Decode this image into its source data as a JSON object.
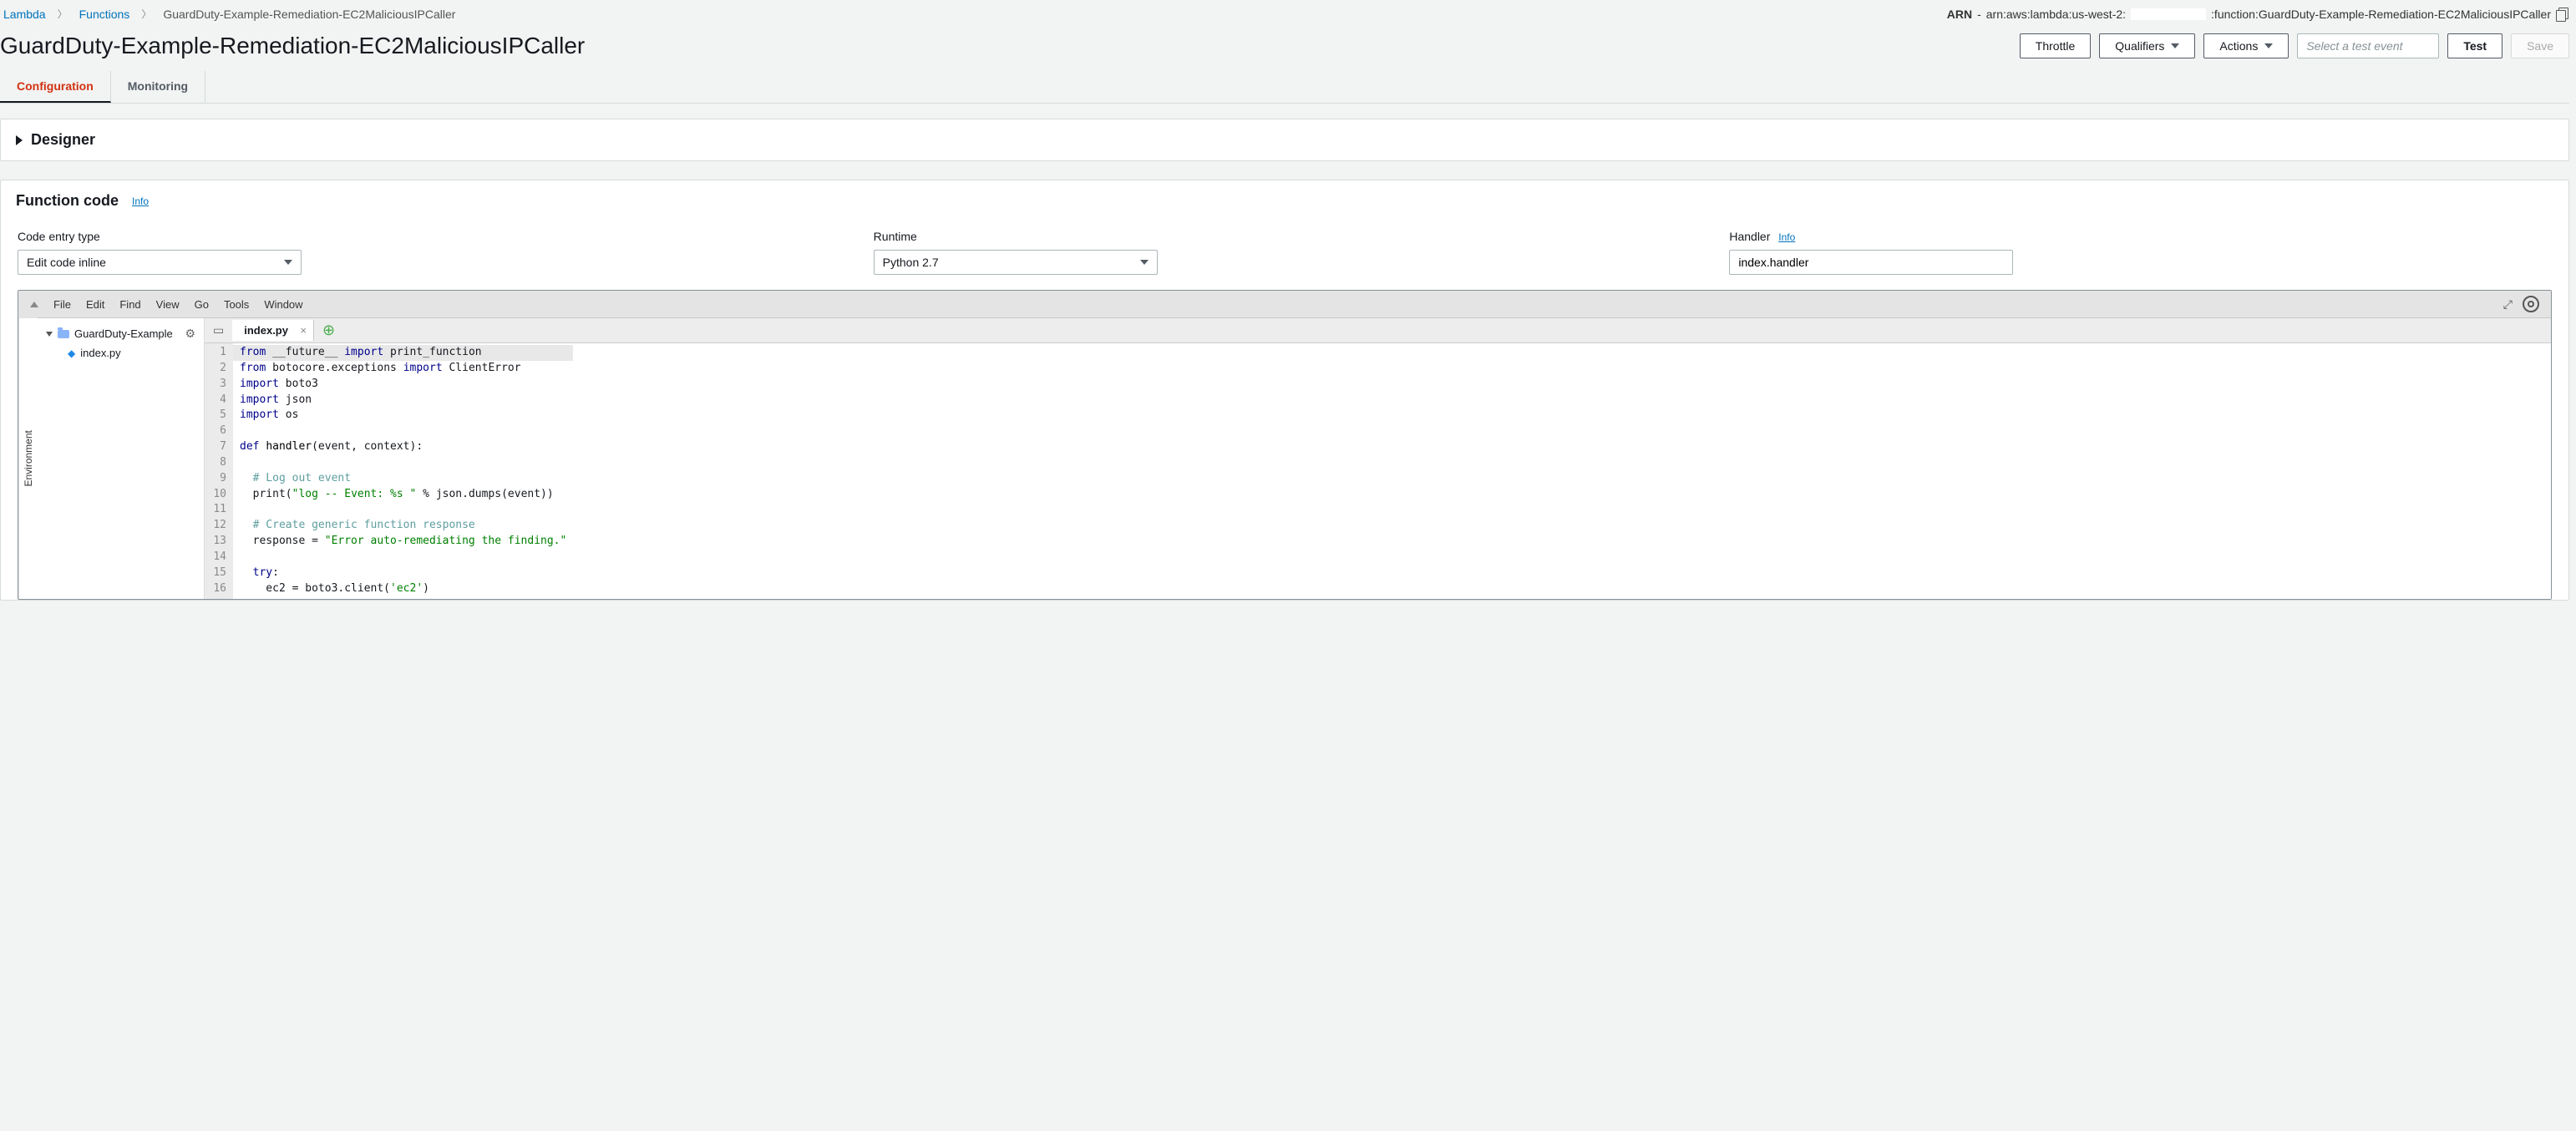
{
  "breadcrumbs": {
    "root": "Lambda",
    "mid": "Functions",
    "current": "GuardDuty-Example-Remediation-EC2MaliciousIPCaller"
  },
  "arn": {
    "label": "ARN",
    "prefix": "arn:aws:lambda:us-west-2:",
    "suffix": ":function:GuardDuty-Example-Remediation-EC2MaliciousIPCaller"
  },
  "title": "GuardDuty-Example-Remediation-EC2MaliciousIPCaller",
  "actions": {
    "throttle": "Throttle",
    "qualifiers": "Qualifiers",
    "actionsBtn": "Actions",
    "testSelectPlaceholder": "Select a test event",
    "test": "Test",
    "save": "Save"
  },
  "tabs": {
    "configuration": "Configuration",
    "monitoring": "Monitoring"
  },
  "designer": {
    "title": "Designer"
  },
  "functionCode": {
    "title": "Function code",
    "infoLabel": "Info",
    "fields": {
      "codeEntry": {
        "label": "Code entry type",
        "value": "Edit code inline"
      },
      "runtime": {
        "label": "Runtime",
        "value": "Python 2.7"
      },
      "handler": {
        "label": "Handler",
        "info": "Info",
        "value": "index.handler"
      }
    }
  },
  "editor": {
    "menus": [
      "File",
      "Edit",
      "Find",
      "View",
      "Go",
      "Tools",
      "Window"
    ],
    "envLabel": "Environment",
    "tree": {
      "root": "GuardDuty-Example",
      "file": "index.py"
    },
    "openTab": "index.py",
    "code": {
      "lines": [
        {
          "n": 1,
          "html": "<span class='kw'>from</span> __future__ <span class='kw'>import</span> print_function"
        },
        {
          "n": 2,
          "html": "<span class='kw'>from</span> botocore.exceptions <span class='kw'>import</span> ClientError"
        },
        {
          "n": 3,
          "html": "<span class='kw'>import</span> boto3"
        },
        {
          "n": 4,
          "html": "<span class='kw'>import</span> json"
        },
        {
          "n": 5,
          "html": "<span class='kw'>import</span> os"
        },
        {
          "n": 6,
          "html": ""
        },
        {
          "n": 7,
          "html": "<span class='kw'>def</span> <span class='fn'>handler</span>(event, context):"
        },
        {
          "n": 8,
          "html": ""
        },
        {
          "n": 9,
          "html": "  <span class='c'># Log out event</span>"
        },
        {
          "n": 10,
          "html": "  print(<span class='s'>\"log -- Event: %s \"</span> % json.dumps(event))"
        },
        {
          "n": 11,
          "html": ""
        },
        {
          "n": 12,
          "html": "  <span class='c'># Create generic function response</span>"
        },
        {
          "n": 13,
          "html": "  response = <span class='s'>\"Error auto-remediating the finding.\"</span>"
        },
        {
          "n": 14,
          "html": ""
        },
        {
          "n": 15,
          "html": "  <span class='kw'>try</span>:"
        },
        {
          "n": 16,
          "html": "    ec2 = boto3.client(<span class='s'>'ec2'</span>)"
        }
      ]
    }
  }
}
